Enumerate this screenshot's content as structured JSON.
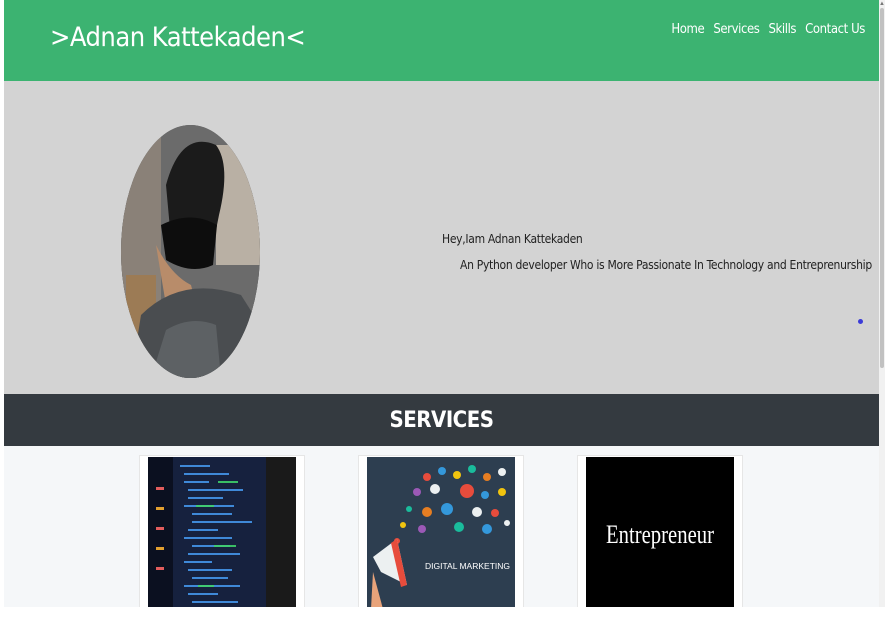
{
  "header": {
    "brand": ">Adnan Kattekaden<",
    "nav": [
      "Home",
      "Services",
      "Skills",
      "Contact Us"
    ]
  },
  "hero": {
    "greeting": "Hey,Iam Adnan Kattekaden",
    "tagline": "An Python developer Who is More Passionate In Technology and Entreprenurship"
  },
  "services": {
    "title": "SERVICES",
    "cards": [
      {
        "image": "code-screen"
      },
      {
        "image": "digital-marketing",
        "caption": "DIGITAL MARKETING"
      },
      {
        "image": "entrepreneur",
        "caption": "Entrepreneur"
      }
    ]
  },
  "colors": {
    "header": "#3cb371",
    "hero": "#d3d3d3",
    "services_bar": "#343a40"
  }
}
